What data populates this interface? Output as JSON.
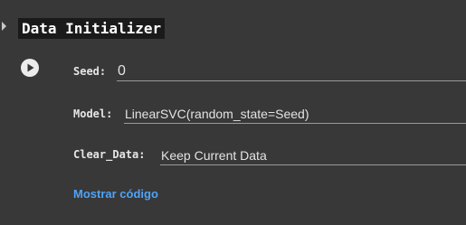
{
  "form": {
    "title": "Data Initializer",
    "fields": [
      {
        "label": "Seed:",
        "value": "0"
      },
      {
        "label": "Model:",
        "value": "LinearSVC(random_state=Seed)"
      },
      {
        "label": "Clear_Data:",
        "value": "Keep Current Data"
      }
    ],
    "show_code_label": "Mostrar código"
  },
  "colors": {
    "background": "#383838",
    "title_background": "#1a1a1a",
    "link": "#4fa3f7"
  },
  "icons": {
    "toggle": "caret-right-icon",
    "run": "play-icon"
  }
}
